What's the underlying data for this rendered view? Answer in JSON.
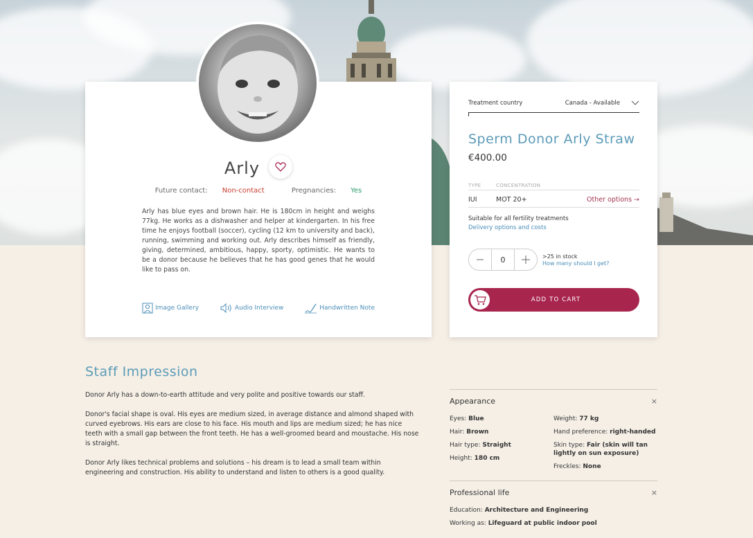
{
  "profile": {
    "name": "Arly",
    "future_contact_label": "Future contact:",
    "future_contact_value": "Non-contact",
    "pregnancies_label": "Pregnancies:",
    "pregnancies_value": "Yes",
    "bio": "Arly has blue eyes and brown hair. He is 180cm in height and weighs 77kg. He works as a dishwasher and helper at kindergarten. In his free time he enjoys football (soccer), cycling (12 km to university and back), running, swimming and working out. Arly describes himself as friendly, giving, determined, ambitious, happy, sporty, optimistic. He wants to be a donor because he believes that he has good genes that he would like to pass on.",
    "links": {
      "gallery": "Image Gallery",
      "audio": "Audio Interview",
      "handwritten": "Handwritten Note"
    }
  },
  "purchase": {
    "country_label": "Treatment country",
    "country_value": "Canada - Available",
    "title": "Sperm Donor Arly Straw",
    "price": "€400.00",
    "type_header": "TYPE",
    "concentration_header": "CONCENTRATION",
    "type_value": "IUI",
    "concentration_value": "MOT 20+",
    "other_options": "Other options →",
    "suitable": "Suitable for all fertility treatments",
    "delivery": "Delivery options and costs",
    "quantity": "0",
    "stock": ">25 in stock",
    "how_many": "How many should I get?",
    "add_to_cart": "ADD TO CART"
  },
  "staff": {
    "title": "Staff Impression",
    "p1": "Donor Arly has a down-to-earth attitude and very polite and positive towards our staff.",
    "p2": "Donor's facial shape is oval. His eyes are medium sized, in average distance and almond shaped with curved eyebrows. His ears are close to his face. His mouth and lips are medium sized; he has nice teeth with a small gap between the front teeth. He has a well-groomed beard and moustache. His nose is straight.",
    "p3": "Donor Arly likes technical problems and solutions – his dream is to lead a small team within engineering and construction. His ability to understand and listen to others is a good quality."
  },
  "appearance": {
    "title": "Appearance",
    "close": "×",
    "eyes_label": "Eyes:",
    "eyes": "Blue",
    "hair_label": "Hair:",
    "hair": "Brown",
    "hair_type_label": "Hair type:",
    "hair_type": "Straight",
    "height_label": "Height:",
    "height": "180 cm",
    "weight_label": "Weight:",
    "weight": "77 kg",
    "hand_label": "Hand preference:",
    "hand": "right-handed",
    "skin_label": "Skin type:",
    "skin": "Fair (skin will tan lightly on sun exposure)",
    "freckles_label": "Freckles:",
    "freckles": "None"
  },
  "professional": {
    "title": "Professional life",
    "close": "×",
    "education_label": "Education:",
    "education": "Architecture and Engineering",
    "working_label": "Working as:",
    "working": "Lifeguard at public indoor pool"
  },
  "colors": {
    "accent_blue": "#5c9bb8",
    "cart_red": "#a8264e",
    "non_contact_red": "#c63b2c",
    "yes_green": "#2e9b6b",
    "background_beige": "#f5efe6"
  }
}
